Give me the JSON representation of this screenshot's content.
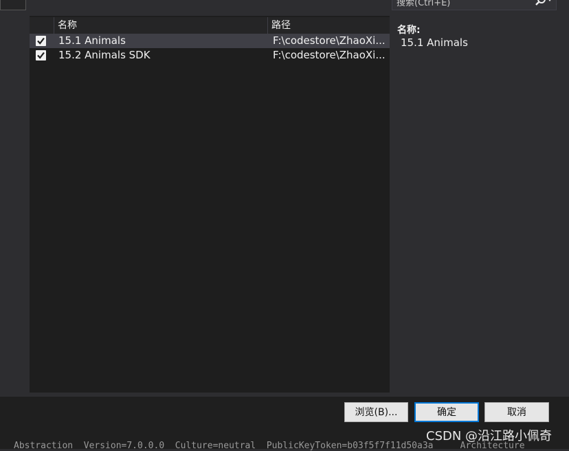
{
  "search": {
    "placeholder": "搜索(Ctrl+E)"
  },
  "list": {
    "columns": {
      "name": "名称",
      "path": "路径"
    },
    "rows": [
      {
        "name": "15.1 Animals",
        "path": "F:\\codestore\\ZhaoXi...",
        "checked": true,
        "selected": true
      },
      {
        "name": "15.2 Animals SDK",
        "path": "F:\\codestore\\ZhaoXi...",
        "checked": true,
        "selected": false
      }
    ]
  },
  "details": {
    "title": "名称:",
    "name": "15.1 Animals"
  },
  "buttons": {
    "browse": "浏览(B)...",
    "ok": "确定",
    "cancel": "取消"
  },
  "status_text": "Abstraction  Version=7.0.0.0  Culture=neutral  PublicKeyToken=b03f5f7f11d50a3a     Architecture",
  "watermark": "CSDN @沿江路小佩奇"
}
